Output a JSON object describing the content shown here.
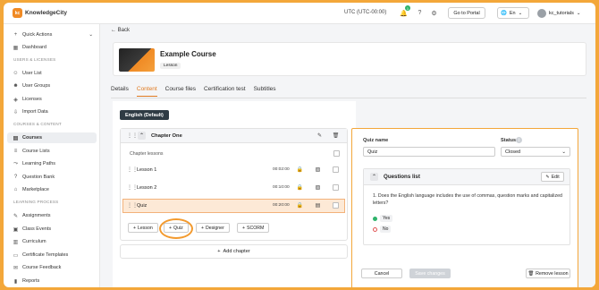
{
  "brand": {
    "name": "KnowledgeCity",
    "badge": "kc"
  },
  "topbar": {
    "time": "UTC (UTC-00:00)",
    "notif_count": "1",
    "portal": "Go to Portal",
    "lang": "En",
    "user": "kc_tutorials"
  },
  "sidebar": {
    "quick_actions": "Quick Actions",
    "dashboard": "Dashboard",
    "sec_users": "USERS & LICENSES",
    "user_list": "User List",
    "user_groups": "User Groups",
    "licenses": "Licenses",
    "import_data": "Import Data",
    "sec_courses": "COURSES & CONTENT",
    "courses": "Courses",
    "course_lists": "Course Lists",
    "learning_paths": "Learning Paths",
    "question_bank": "Question Bank",
    "marketplace": "Marketplace",
    "sec_learning": "LEARNING PROCESS",
    "assignments": "Assignments",
    "class_events": "Class Events",
    "curriculum": "Curriculum",
    "certificate_templates": "Certificate Templates",
    "course_feedback": "Course Feedback",
    "reports": "Reports"
  },
  "main": {
    "back": "Back",
    "course_title": "Example Course",
    "course_tag": "Lesson",
    "tabs": [
      "Details",
      "Content",
      "Course files",
      "Certification test",
      "Subtitles"
    ],
    "language_btn": "English (Default)",
    "chapter_title": "Chapter One",
    "chapter_lessons": "Chapter lessons",
    "lessons": [
      {
        "title": "Lesson 1",
        "time": "00:02:00"
      },
      {
        "title": "Lesson 2",
        "time": "00:10:00"
      },
      {
        "title": "Quiz",
        "time": "00:20:00"
      }
    ],
    "add_buttons": {
      "lesson": "Lesson",
      "quiz": "Quiz",
      "designer": "Designer",
      "scorm": "SCORM"
    },
    "add_chapter": "Add chapter"
  },
  "quiz": {
    "name_label": "Quiz name",
    "name_value": "Quiz",
    "status_label": "Status",
    "status_value": "Closed",
    "questions_list": "Questions list",
    "edit": "Edit",
    "question": "1. Does the English language includes the use of commas, question marks and capitalized letters?",
    "answers": [
      {
        "text": "Yes",
        "correct": true
      },
      {
        "text": "No",
        "correct": false
      }
    ],
    "cancel": "Cancel",
    "save": "Save changes",
    "remove": "Remove lesson"
  },
  "colors": {
    "accent": "#e07a20",
    "frame": "#f3a73a",
    "dark_button": "#2f3b44",
    "correct": "#2fb36b",
    "wrong": "#e05252"
  }
}
